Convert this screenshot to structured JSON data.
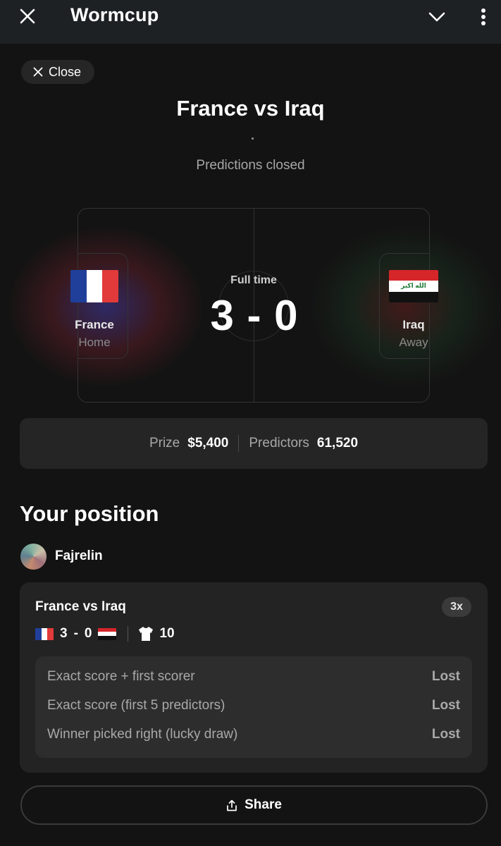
{
  "topbar": {
    "title": "Wormcup"
  },
  "close_chip": {
    "label": "Close"
  },
  "match": {
    "title": "France vs Iraq",
    "status": "Predictions closed",
    "period": "Full time",
    "score": "3 - 0",
    "home": {
      "name": "France",
      "side": "Home",
      "flag_colors": [
        "#1f3f9a",
        "#ffffff",
        "#e23a3a"
      ]
    },
    "away": {
      "name": "Iraq",
      "side": "Away",
      "flag_colors": [
        "#d6262a",
        "#ffffff",
        "#111111"
      ],
      "flag_script": "الله اكبر"
    }
  },
  "stats": {
    "prize_label": "Prize",
    "prize_value": "$5,400",
    "predictors_label": "Predictors",
    "predictors_value": "61,520"
  },
  "position": {
    "heading": "Your position",
    "user": {
      "name": "Fajrelin"
    },
    "card": {
      "title": "France vs Iraq",
      "multiplier": "3x",
      "predicted_home": "3",
      "predicted_dash": "-",
      "predicted_away": "0",
      "first_scorer_number": "10",
      "results": [
        {
          "label": "Exact score + first scorer",
          "status": "Lost"
        },
        {
          "label": "Exact score (first 5 predictors)",
          "status": "Lost"
        },
        {
          "label": "Winner picked right (lucky draw)",
          "status": "Lost"
        }
      ]
    }
  },
  "share": {
    "label": "Share"
  }
}
